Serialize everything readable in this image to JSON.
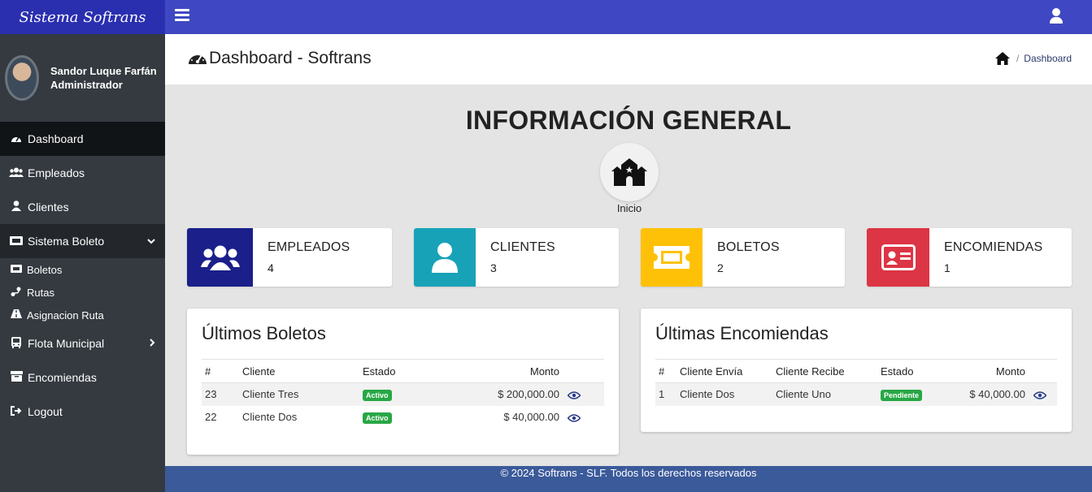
{
  "app": {
    "brand": "Sistema Softrans"
  },
  "user": {
    "name": "Sandor Luque Farfán",
    "role": "Administrador"
  },
  "sidebar": {
    "items": [
      {
        "label": "Dashboard",
        "icon": "dashboard-icon"
      },
      {
        "label": "Empleados",
        "icon": "users-icon"
      },
      {
        "label": "Clientes",
        "icon": "user-icon"
      },
      {
        "label": "Sistema Boleto",
        "icon": "ticket-icon"
      },
      {
        "label": "Flota Municipal",
        "icon": "bus-icon"
      },
      {
        "label": "Encomiendas",
        "icon": "box-icon"
      },
      {
        "label": "Logout",
        "icon": "logout-icon"
      }
    ],
    "subitems": [
      {
        "label": "Boletos",
        "icon": "ticket-icon"
      },
      {
        "label": "Rutas",
        "icon": "route-icon"
      },
      {
        "label": "Asignacion Ruta",
        "icon": "road-icon"
      }
    ]
  },
  "header": {
    "title": "Dashboard - Softrans",
    "breadcrumb": "Dashboard"
  },
  "main": {
    "title": "INFORMACIÓN GENERAL",
    "inicio_label": "Inicio",
    "cards": [
      {
        "label": "EMPLEADOS",
        "value": "4",
        "color": "#1a1f8a"
      },
      {
        "label": "CLIENTES",
        "value": "3",
        "color": "#17a2b8"
      },
      {
        "label": "BOLETOS",
        "value": "2",
        "color": "#ffc107"
      },
      {
        "label": "ENCOMIENDAS",
        "value": "1",
        "color": "#dc3545"
      }
    ]
  },
  "boletos": {
    "title": "Últimos Boletos",
    "headers": [
      "#",
      "Cliente",
      "Estado",
      "Monto"
    ],
    "rows": [
      {
        "id": "23",
        "cliente": "Cliente Tres",
        "estado": "Activo",
        "monto": "$ 200,000.00"
      },
      {
        "id": "22",
        "cliente": "Cliente Dos",
        "estado": "Activo",
        "monto": "$ 40,000.00"
      }
    ]
  },
  "encomiendas": {
    "title": "Últimas Encomiendas",
    "headers": [
      "#",
      "Cliente Envía",
      "Cliente Recibe",
      "Estado",
      "Monto"
    ],
    "rows": [
      {
        "id": "1",
        "envia": "Cliente Dos",
        "recibe": "Cliente Uno",
        "estado": "Pendiente",
        "monto": "$ 40,000.00"
      }
    ]
  },
  "footer": {
    "text": "© 2024 Softrans - SLF. Todos los derechos reservados"
  },
  "colors": {
    "topbar": "#3f48c2",
    "brand": "#2a2fb0",
    "sidebar": "#343a40",
    "footer": "#3b5a9a",
    "badge_green": "#28a745"
  }
}
